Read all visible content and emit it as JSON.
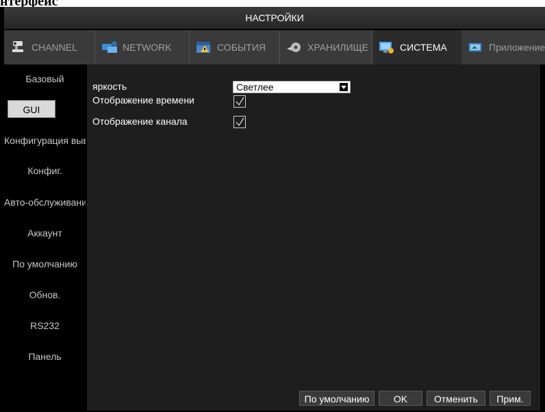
{
  "doc_heading": "нтерфейс",
  "window": {
    "title": "НАСТРОЙКИ"
  },
  "tabs": [
    {
      "label": "CHANNEL",
      "icon": "camera-icon",
      "active": false
    },
    {
      "label": "NETWORK",
      "icon": "network-icon",
      "active": false
    },
    {
      "label": "СОБЫТИЯ",
      "icon": "events-icon",
      "active": false
    },
    {
      "label": "ХРАНИЛИЩЕ",
      "icon": "storage-icon",
      "active": false
    },
    {
      "label": "СИСТЕМА",
      "icon": "system-icon",
      "active": true
    },
    {
      "label": "Приложение",
      "icon": "apps-icon",
      "active": false
    }
  ],
  "sidebar": {
    "items": [
      {
        "label": "Базовый",
        "selected": false
      },
      {
        "label": "GUI",
        "selected": true
      },
      {
        "label": "Конфигурация вывода",
        "selected": false
      },
      {
        "label": "Конфиг.",
        "selected": false
      },
      {
        "label": "Авто-обслуживание",
        "selected": false
      },
      {
        "label": "Аккаунт",
        "selected": false
      },
      {
        "label": "По умолчанию",
        "selected": false
      },
      {
        "label": "Обнов.",
        "selected": false
      },
      {
        "label": "RS232",
        "selected": false
      },
      {
        "label": "Панель",
        "selected": false
      }
    ]
  },
  "settings": {
    "brightness": {
      "label": "яркость",
      "value": "Светлее"
    },
    "time_display": {
      "label": "Отображение времени",
      "checked": true
    },
    "channel_display": {
      "label": "Отображение канала",
      "checked": true
    }
  },
  "buttons": {
    "default": "По умолчанию",
    "ok": "OK",
    "cancel": "Отменить",
    "apply": "Прим."
  }
}
